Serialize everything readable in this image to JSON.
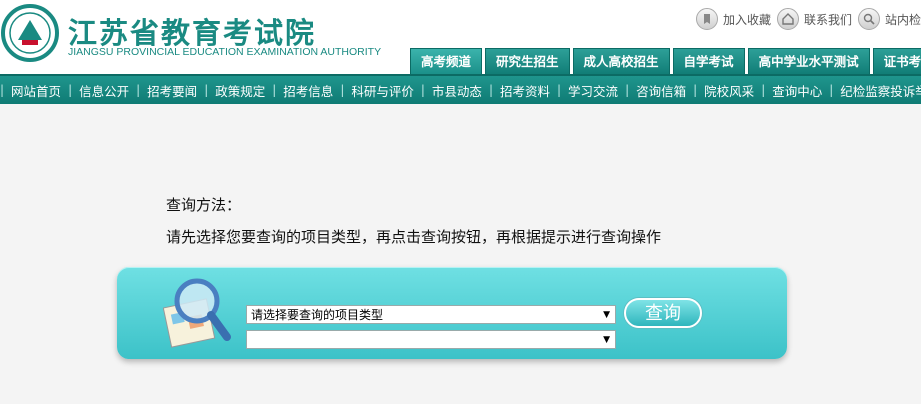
{
  "header": {
    "title_cn": "江苏省教育考试院",
    "title_en": "JIANGSU PROVINCIAL EDUCATION EXAMINATION AUTHORITY",
    "top_links": [
      {
        "label": "加入收藏",
        "icon": "bookmark-icon"
      },
      {
        "label": "联系我们",
        "icon": "home-icon"
      },
      {
        "label": "站内检",
        "icon": "search-icon"
      }
    ]
  },
  "tabs": [
    "高考频道",
    "研究生招生",
    "成人高校招生",
    "自学考试",
    "高中学业水平测试",
    "证书考试"
  ],
  "nav": [
    "网站首页",
    "信息公开",
    "招考要闻",
    "政策规定",
    "招考信息",
    "科研与评价",
    "市县动态",
    "招考资料",
    "学习交流",
    "咨询信箱",
    "院校风采",
    "查询中心",
    "纪检监察投诉举报"
  ],
  "content": {
    "method_title": "查询方法：",
    "method_desc": "请先选择您要查询的项目类型，再点击查询按钮，再根据提示进行查询操作",
    "select_type_value": "请选择要查询的项目类型",
    "select_sub_value": "",
    "query_button": "查询"
  },
  "colors": {
    "brand": "#1a8a82",
    "nav_bg": "#138078",
    "panel": "#4ccbd0"
  }
}
